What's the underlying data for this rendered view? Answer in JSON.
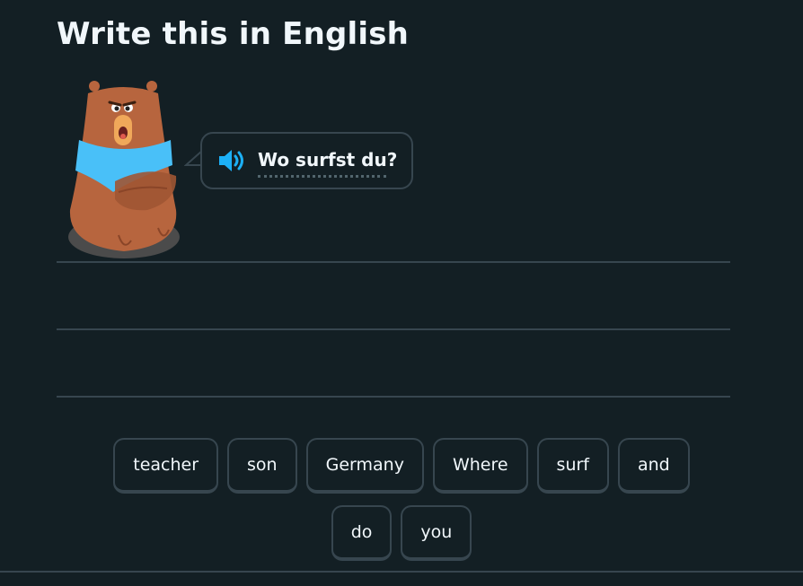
{
  "header": {
    "title": "Write this in English"
  },
  "prompt": {
    "text": "Wo surfst du?",
    "speaker_icon": "speaker-icon",
    "character_icon": "bear-character"
  },
  "word_bank": {
    "row1": [
      "teacher",
      "son",
      "Germany",
      "Where",
      "surf",
      "and"
    ],
    "row2": [
      "do",
      "you"
    ]
  },
  "colors": {
    "background": "#131f24",
    "border": "#37464f",
    "text": "#f1f7fb",
    "speaker": "#1cb0f6",
    "bear_fur": "#b7653e",
    "scarf": "#49c0f8"
  }
}
